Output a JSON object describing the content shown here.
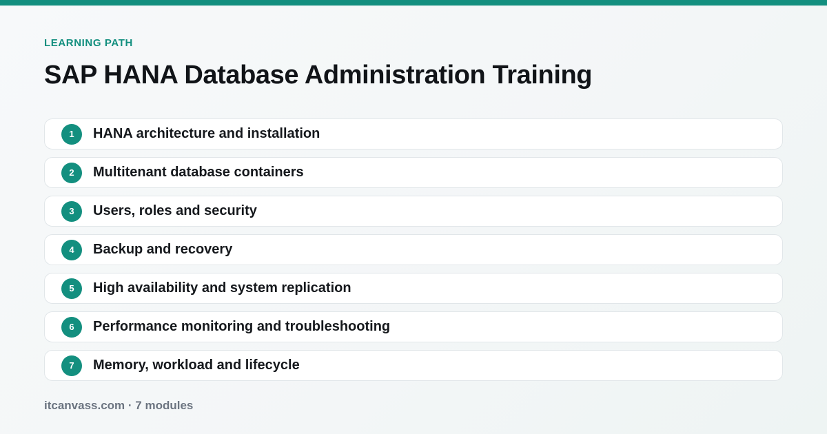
{
  "colors": {
    "accent": "#138f7f",
    "title": "#111418",
    "muted": "#6b7480",
    "card_border": "#e1e6e9",
    "card_background": "#ffffff"
  },
  "header": {
    "eyebrow": "LEARNING PATH",
    "title": "SAP HANA Database Administration Training"
  },
  "modules": [
    {
      "number": "1",
      "label": "HANA architecture and installation"
    },
    {
      "number": "2",
      "label": "Multitenant database containers"
    },
    {
      "number": "3",
      "label": "Users, roles and security"
    },
    {
      "number": "4",
      "label": "Backup and recovery"
    },
    {
      "number": "5",
      "label": "High availability and system replication"
    },
    {
      "number": "6",
      "label": "Performance monitoring and troubleshooting"
    },
    {
      "number": "7",
      "label": "Memory, workload and lifecycle"
    }
  ],
  "footer": {
    "text": "itcanvass.com · 7 modules"
  }
}
